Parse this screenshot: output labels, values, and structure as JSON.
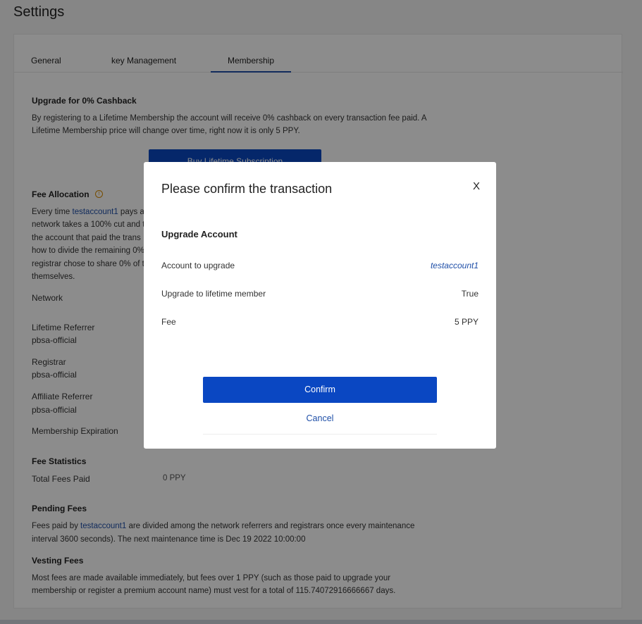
{
  "page": {
    "title": "Settings"
  },
  "tabs": [
    {
      "label": "General"
    },
    {
      "label": "key Management"
    },
    {
      "label": "Membership"
    }
  ],
  "upgrade": {
    "title": "Upgrade for 0% Cashback",
    "text_line1": "By registering to a Lifetime Membership the account will receive 0% cashback on every transaction fee paid. A",
    "text_line2": "Lifetime Membership price will change over time, right now it is only 5 PPY.",
    "button": "Buy Lifetime Subscription"
  },
  "fee_allocation": {
    "title": "Fee Allocation",
    "line1_pre": "Every time ",
    "account": "testaccount1",
    "line1_post": " pays a",
    "line2": "network takes a 100% cut and t",
    "line3": "the account that paid the trans",
    "line4": "how to divide the remaining 0%",
    "line5": "registrar chose to share 0% of t",
    "line6": "themselves.",
    "network_label": "Network",
    "lifetime_referrer_label": "Lifetime Referrer",
    "lifetime_referrer_value": "pbsa-official",
    "registrar_label": "Registrar",
    "registrar_value": "pbsa-official",
    "affiliate_referrer_label": "Affiliate Referrer",
    "affiliate_referrer_value": "pbsa-official",
    "expiration_label": "Membership Expiration"
  },
  "fee_statistics": {
    "title": "Fee Statistics",
    "total_label": "Total Fees Paid",
    "total_value": "0 PPY"
  },
  "pending_fees": {
    "title": "Pending Fees",
    "line1_pre": "Fees paid by ",
    "account": "testaccount1",
    "line1_post": " are divided among the network referrers and registrars once every maintenance",
    "line2": "interval 3600 seconds). The next maintenance time is Dec 19 2022 10:00:00"
  },
  "vesting_fees": {
    "title": "Vesting Fees",
    "line1": "Most fees are made available immediately, but fees over 1 PPY (such as those paid to upgrade your",
    "line2": "membership or register a premium account name) must vest for a total of 115.74072916666667 days."
  },
  "modal": {
    "title": "Please confirm the transaction",
    "close": "X",
    "subtitle": "Upgrade Account",
    "rows": [
      {
        "label": "Account to upgrade",
        "value": "testaccount1"
      },
      {
        "label": "Upgrade to lifetime member",
        "value": "True"
      },
      {
        "label": "Fee",
        "value": "5 PPY"
      }
    ],
    "confirm": "Confirm",
    "cancel": "Cancel"
  },
  "colors": {
    "accent": "#0a47c2",
    "link": "#1f4fa8",
    "warning": "#d98c00"
  },
  "icons": {
    "info": "info-circle-icon"
  }
}
